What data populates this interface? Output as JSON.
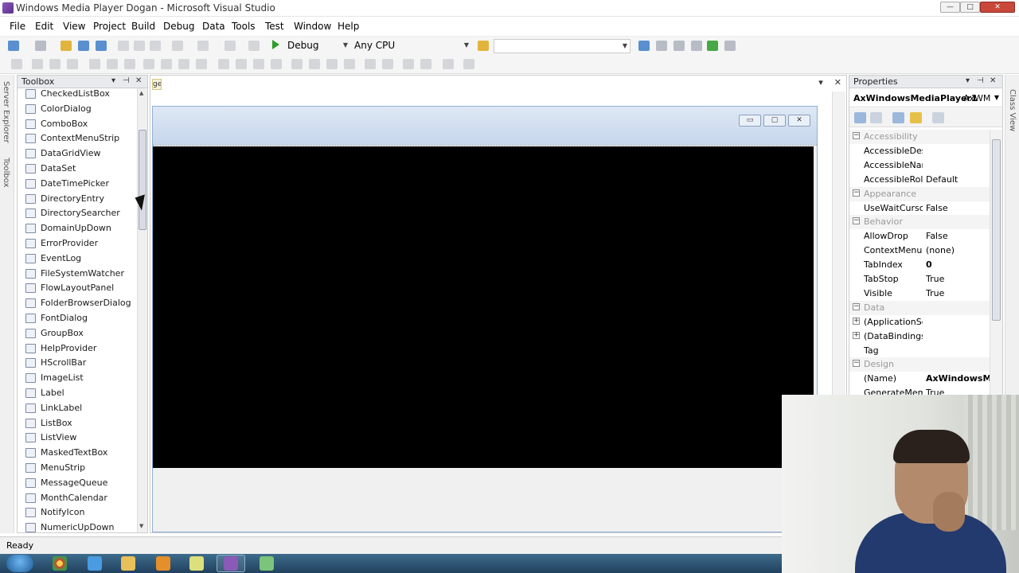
{
  "window": {
    "title": "Windows Media Player Dogan - Microsoft Visual Studio",
    "min": "—",
    "max": "□",
    "close": "✕"
  },
  "menu": [
    "File",
    "Edit",
    "View",
    "Project",
    "Build",
    "Debug",
    "Data",
    "Tools",
    "Test",
    "Window",
    "Help"
  ],
  "toolbar": {
    "config": "Debug",
    "platform": "Any CPU"
  },
  "left_strip": {
    "server_explorer": "Server Explorer",
    "toolbox": "Toolbox"
  },
  "toolbox": {
    "title": "Toolbox",
    "items": [
      {
        "label": "CheckedListBox",
        "icon": "checkedlist-icon"
      },
      {
        "label": "ColorDialog",
        "icon": "color-dialog-icon"
      },
      {
        "label": "ComboBox",
        "icon": "combobox-icon"
      },
      {
        "label": "ContextMenuStrip",
        "icon": "context-menu-icon"
      },
      {
        "label": "DataGridView",
        "icon": "datagrid-icon"
      },
      {
        "label": "DataSet",
        "icon": "dataset-icon"
      },
      {
        "label": "DateTimePicker",
        "icon": "datetime-icon"
      },
      {
        "label": "DirectoryEntry",
        "icon": "directory-entry-icon"
      },
      {
        "label": "DirectorySearcher",
        "icon": "directory-searcher-icon"
      },
      {
        "label": "DomainUpDown",
        "icon": "domain-updown-icon"
      },
      {
        "label": "ErrorProvider",
        "icon": "error-provider-icon"
      },
      {
        "label": "EventLog",
        "icon": "eventlog-icon"
      },
      {
        "label": "FileSystemWatcher",
        "icon": "filesystem-watcher-icon"
      },
      {
        "label": "FlowLayoutPanel",
        "icon": "flow-layout-icon"
      },
      {
        "label": "FolderBrowserDialog",
        "icon": "folder-browser-icon"
      },
      {
        "label": "FontDialog",
        "icon": "font-dialog-icon"
      },
      {
        "label": "GroupBox",
        "icon": "groupbox-icon"
      },
      {
        "label": "HelpProvider",
        "icon": "help-provider-icon"
      },
      {
        "label": "HScrollBar",
        "icon": "hscrollbar-icon"
      },
      {
        "label": "ImageList",
        "icon": "imagelist-icon"
      },
      {
        "label": "Label",
        "icon": "label-icon"
      },
      {
        "label": "LinkLabel",
        "icon": "linklabel-icon"
      },
      {
        "label": "ListBox",
        "icon": "listbox-icon"
      },
      {
        "label": "ListView",
        "icon": "listview-icon"
      },
      {
        "label": "MaskedTextBox",
        "icon": "masked-textbox-icon"
      },
      {
        "label": "MenuStrip",
        "icon": "menustrip-icon"
      },
      {
        "label": "MessageQueue",
        "icon": "message-queue-icon"
      },
      {
        "label": "MonthCalendar",
        "icon": "month-calendar-icon"
      },
      {
        "label": "NotifyIcon",
        "icon": "notify-icon"
      },
      {
        "label": "NumericUpDown",
        "icon": "numeric-updown-icon"
      }
    ]
  },
  "designer": {
    "tab_fragment": "ge",
    "close": "✕",
    "dropdown": "▾"
  },
  "form": {
    "min": "▭",
    "max": "▢",
    "close": "✕"
  },
  "properties": {
    "title": "Properties",
    "object_name": "AxWindowsMediaPlayer1",
    "object_type": "AxWM",
    "rows": [
      {
        "kind": "cat",
        "name": "Accessibility",
        "value": ""
      },
      {
        "kind": "prop",
        "name": "AccessibleDesc",
        "value": ""
      },
      {
        "kind": "prop",
        "name": "AccessibleNam",
        "value": ""
      },
      {
        "kind": "prop",
        "name": "AccessibleRole",
        "value": "Default"
      },
      {
        "kind": "cat",
        "name": "Appearance",
        "value": ""
      },
      {
        "kind": "prop",
        "name": "UseWaitCursor",
        "value": "False"
      },
      {
        "kind": "cat",
        "name": "Behavior",
        "value": ""
      },
      {
        "kind": "prop",
        "name": "AllowDrop",
        "value": "False"
      },
      {
        "kind": "prop",
        "name": "ContextMenuS",
        "value": "(none)"
      },
      {
        "kind": "prop",
        "name": "TabIndex",
        "value": "0"
      },
      {
        "kind": "prop",
        "name": "TabStop",
        "value": "True"
      },
      {
        "kind": "prop",
        "name": "Visible",
        "value": "True"
      },
      {
        "kind": "cat",
        "name": "Data",
        "value": ""
      },
      {
        "kind": "exp",
        "name": "(ApplicationSe",
        "value": ""
      },
      {
        "kind": "exp",
        "name": "(DataBindings)",
        "value": ""
      },
      {
        "kind": "prop",
        "name": "Tag",
        "value": ""
      },
      {
        "kind": "cat",
        "name": "Design",
        "value": ""
      },
      {
        "kind": "prop",
        "name": "(Name)",
        "value": "AxWindowsMe"
      },
      {
        "kind": "prop",
        "name": "GenerateMeml",
        "value": "True"
      }
    ]
  },
  "right_strip": {
    "class_view": "Class View"
  },
  "status": {
    "text": "Ready"
  }
}
